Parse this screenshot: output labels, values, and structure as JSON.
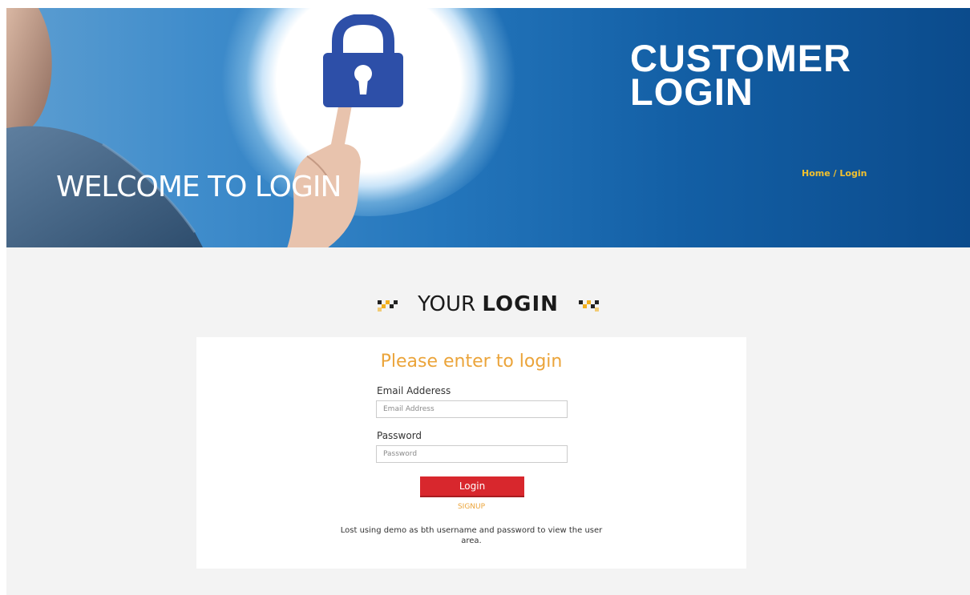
{
  "banner": {
    "title_line1": "CUSTOMER",
    "title_line2": "LOGIN",
    "welcome": "WELCOME TO LOGIN",
    "breadcrumb_home": "Home",
    "breadcrumb_sep": "/",
    "breadcrumb_current": "Login"
  },
  "section": {
    "heading_light": "YOUR",
    "heading_bold": "LOGIN"
  },
  "form": {
    "title": "Please enter to login",
    "email_label": "Email Adderess",
    "email_placeholder": "Email Address",
    "password_label": "Password",
    "password_placeholder": "Password",
    "login_button": "Login",
    "signup_link": "SIGNUP",
    "note": "Lost using demo as bth username and password to view the user area."
  },
  "colors": {
    "accent_orange": "#eba43a",
    "button_red": "#d8272d",
    "breadcrumb_yellow": "#f2c12e",
    "banner_blue": "#135fa5"
  },
  "icons": [
    "padlock-icon",
    "decorative-checker-icon"
  ]
}
